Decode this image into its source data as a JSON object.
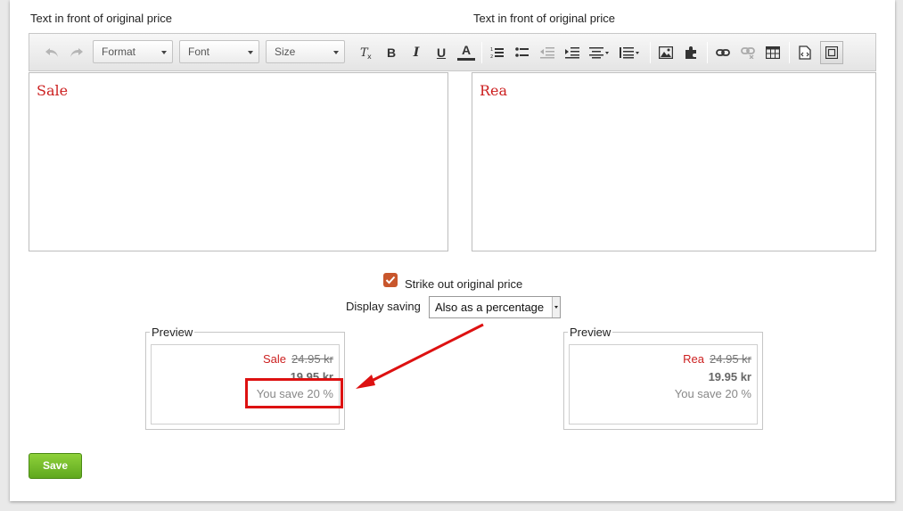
{
  "labels": {
    "left_editor": "Text in front of original price",
    "right_editor": "Text in front of original price"
  },
  "toolbar": {
    "format_label": "Format",
    "font_label": "Font",
    "size_label": "Size",
    "bold": "B",
    "italic": "I",
    "underline": "U",
    "font_color": "A",
    "icons": [
      "undo-icon",
      "redo-icon",
      "remove-format-icon",
      "bold-icon",
      "italic-icon",
      "underline-icon",
      "font-color-icon",
      "numbered-list-icon",
      "bullet-list-icon",
      "outdent-icon",
      "indent-icon",
      "align-icon",
      "line-height-icon",
      "image-icon",
      "plugin-icon",
      "link-icon",
      "unlink-icon",
      "table-icon",
      "source-icon",
      "fullscreen-icon"
    ]
  },
  "editors": {
    "left_text": "Sale",
    "right_text": "Rea",
    "text_color": "#cc1f1f"
  },
  "options": {
    "strike_label": "Strike out original price",
    "strike_checked": true,
    "display_saving_label": "Display saving",
    "display_saving_value": "Also as a percentage"
  },
  "previews": [
    {
      "legend": "Preview",
      "prefix": "Sale",
      "original_price": "24.95 kr",
      "new_price": "19.95 kr",
      "saving": "You save 20 %"
    },
    {
      "legend": "Preview",
      "prefix": "Rea",
      "original_price": "24.95 kr",
      "new_price": "19.95 kr",
      "saving": "You save 20 %"
    }
  ],
  "save_label": "Save",
  "colors": {
    "accent_red": "#cc1f1f",
    "save_green": "#6fb428",
    "checkbox": "#c8562c",
    "annotation_red": "#dd1111"
  }
}
